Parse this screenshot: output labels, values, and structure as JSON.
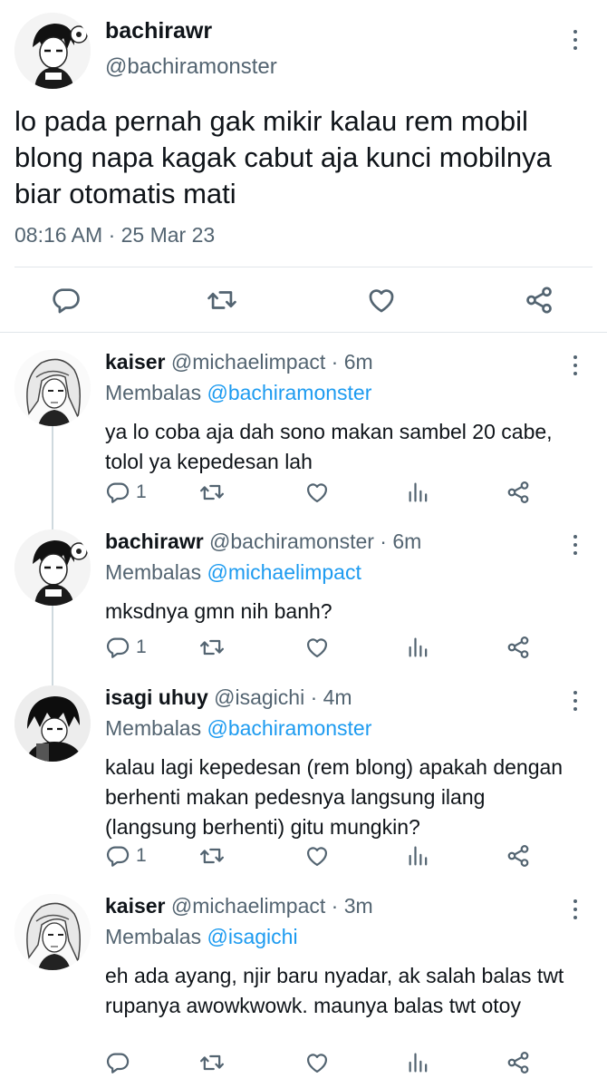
{
  "main_tweet": {
    "display_name": "bachirawr",
    "handle": "@bachiramonster",
    "text": "lo pada pernah gak mikir kalau rem mobil blong napa kagak cabut aja kunci mobilnya biar otomatis mati",
    "timestamp": "08:16 AM · 25 Mar 23"
  },
  "replies": [
    {
      "display_name": "kaiser",
      "handle": "@michaelimpact · 6m",
      "replying_label": "Membalas",
      "replying_to": "@bachiramonster",
      "text": "ya lo coba aja dah sono makan sambel 20 cabe, tolol ya kepedesan lah",
      "reply_count": "1"
    },
    {
      "display_name": "bachirawr",
      "handle": "@bachiramonster · 6m",
      "replying_label": "Membalas",
      "replying_to": "@michaelimpact",
      "text": "mksdnya gmn nih banh?",
      "reply_count": "1"
    },
    {
      "display_name": "isagi uhuy",
      "handle": "@isagichi · 4m",
      "replying_label": "Membalas",
      "replying_to": "@bachiramonster",
      "text": "kalau lagi kepedesan (rem blong) apakah dengan berhenti makan pedesnya langsung ilang (langsung berhenti) gitu mungkin?",
      "reply_count": "1"
    },
    {
      "display_name": "kaiser",
      "handle": "@michaelimpact · 3m",
      "replying_label": "Membalas",
      "replying_to": "@isagichi",
      "text": "eh ada ayang, njir baru nyadar, ak salah balas twt rupanya awowkwowk. maunya balas twt otoy",
      "reply_count": ""
    }
  ],
  "colors": {
    "link": "#1d9bf0",
    "secondary": "#536471",
    "divider": "#e1e6ea"
  },
  "icons": [
    "reply-icon",
    "retweet-icon",
    "like-icon",
    "share-icon",
    "analytics-icon",
    "more-icon"
  ]
}
